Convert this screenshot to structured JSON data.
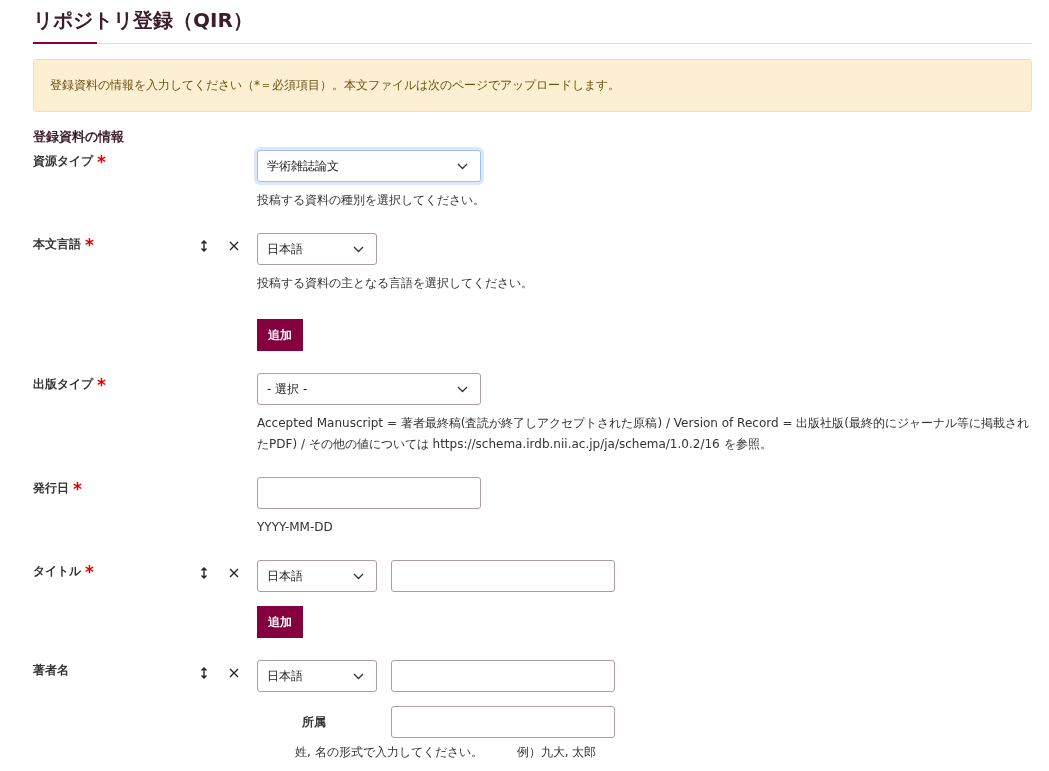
{
  "page": {
    "title": "リポジトリ登録（QIR）"
  },
  "notice": "登録資料の情報を入力してください（*＝必須項目）。本文ファイルは次のページでアップロードします。",
  "section_title": "登録資料の情報",
  "fields": [
    {
      "kind": "select",
      "label": "資源タイプ",
      "required_mark": "*",
      "value": "学術雑誌論文",
      "focused": true,
      "help": "投稿する資料の種別を選択してください。"
    },
    {
      "kind": "language",
      "label": "本文言語",
      "required_mark": "*",
      "entries": [
        {
          "language": "日本語"
        }
      ],
      "help": "投稿する資料の主となる言語を選択してください。",
      "add_button": "追加"
    },
    {
      "kind": "select",
      "label": "出版タイプ",
      "required_mark": "*",
      "value": "- 選択 -",
      "focused": false,
      "help": "Accepted Manuscript = 著者最終稿(査読が終了しアクセプトされた原稿) / Version of Record = 出版社版(最終的にジャーナル等に掲載されたPDF) / その他の値については https://schema.irdb.nii.ac.jp/ja/schema/1.0.2/16 を参照。"
    },
    {
      "kind": "text",
      "label": "発行日",
      "required_mark": "*",
      "help": "YYYY-MM-DD"
    },
    {
      "kind": "lang_text",
      "label": "タイトル",
      "required_mark": "*",
      "entries": [
        {
          "language": "日本語"
        }
      ],
      "add_button": "追加"
    },
    {
      "kind": "author",
      "label": "著者名",
      "entries": [
        {
          "language": "日本語",
          "affiliation_label": "所属"
        }
      ],
      "help": "姓, 名の形式で入力してください。",
      "example": "例）九大, 太郎"
    }
  ]
}
